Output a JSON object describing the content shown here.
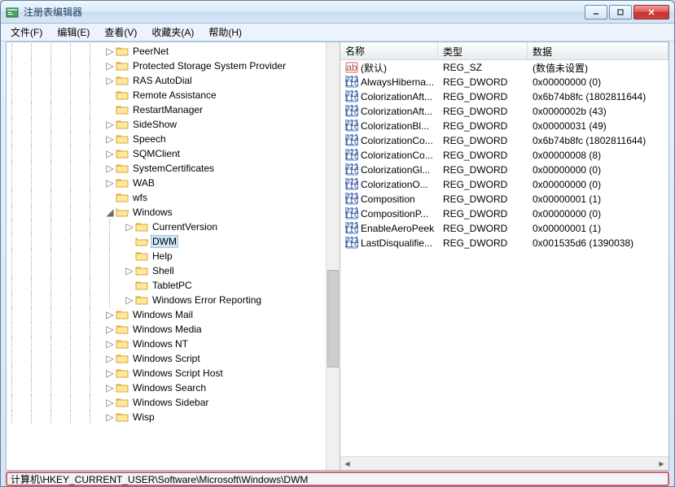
{
  "window": {
    "title": "注册表编辑器"
  },
  "menu": {
    "file": "文件(F)",
    "edit": "编辑(E)",
    "view": "查看(V)",
    "favorites": "收藏夹(A)",
    "help": "帮助(H)"
  },
  "tree": {
    "items": [
      {
        "depth": 5,
        "exp": "closed",
        "label": "PeerNet"
      },
      {
        "depth": 5,
        "exp": "closed",
        "label": "Protected Storage System Provider"
      },
      {
        "depth": 5,
        "exp": "closed",
        "label": "RAS AutoDial"
      },
      {
        "depth": 5,
        "exp": "none",
        "label": "Remote Assistance"
      },
      {
        "depth": 5,
        "exp": "none",
        "label": "RestartManager"
      },
      {
        "depth": 5,
        "exp": "closed",
        "label": "SideShow"
      },
      {
        "depth": 5,
        "exp": "closed",
        "label": "Speech"
      },
      {
        "depth": 5,
        "exp": "closed",
        "label": "SQMClient"
      },
      {
        "depth": 5,
        "exp": "closed",
        "label": "SystemCertificates"
      },
      {
        "depth": 5,
        "exp": "closed",
        "label": "WAB"
      },
      {
        "depth": 5,
        "exp": "none",
        "label": "wfs"
      },
      {
        "depth": 5,
        "exp": "open",
        "label": "Windows"
      },
      {
        "depth": 6,
        "exp": "closed",
        "label": "CurrentVersion"
      },
      {
        "depth": 6,
        "exp": "none",
        "label": "DWM",
        "selected": true
      },
      {
        "depth": 6,
        "exp": "none",
        "label": "Help"
      },
      {
        "depth": 6,
        "exp": "closed",
        "label": "Shell"
      },
      {
        "depth": 6,
        "exp": "none",
        "label": "TabletPC"
      },
      {
        "depth": 6,
        "exp": "closed",
        "label": "Windows Error Reporting"
      },
      {
        "depth": 5,
        "exp": "closed",
        "label": "Windows Mail"
      },
      {
        "depth": 5,
        "exp": "closed",
        "label": "Windows Media"
      },
      {
        "depth": 5,
        "exp": "closed",
        "label": "Windows NT"
      },
      {
        "depth": 5,
        "exp": "closed",
        "label": "Windows Script"
      },
      {
        "depth": 5,
        "exp": "closed",
        "label": "Windows Script Host"
      },
      {
        "depth": 5,
        "exp": "closed",
        "label": "Windows Search"
      },
      {
        "depth": 5,
        "exp": "closed",
        "label": "Windows Sidebar"
      },
      {
        "depth": 5,
        "exp": "closed",
        "label": "Wisp"
      }
    ]
  },
  "list": {
    "headers": {
      "name": "名称",
      "type": "类型",
      "data": "数据"
    },
    "rows": [
      {
        "icon": "str",
        "name": "(默认)",
        "type": "REG_SZ",
        "data": "(数值未设置)"
      },
      {
        "icon": "bin",
        "name": "AlwaysHiberna...",
        "type": "REG_DWORD",
        "data": "0x00000000 (0)"
      },
      {
        "icon": "bin",
        "name": "ColorizationAft...",
        "type": "REG_DWORD",
        "data": "0x6b74b8fc (1802811644)"
      },
      {
        "icon": "bin",
        "name": "ColorizationAft...",
        "type": "REG_DWORD",
        "data": "0x0000002b (43)"
      },
      {
        "icon": "bin",
        "name": "ColorizationBl...",
        "type": "REG_DWORD",
        "data": "0x00000031 (49)"
      },
      {
        "icon": "bin",
        "name": "ColorizationCo...",
        "type": "REG_DWORD",
        "data": "0x6b74b8fc (1802811644)"
      },
      {
        "icon": "bin",
        "name": "ColorizationCo...",
        "type": "REG_DWORD",
        "data": "0x00000008 (8)"
      },
      {
        "icon": "bin",
        "name": "ColorizationGl...",
        "type": "REG_DWORD",
        "data": "0x00000000 (0)"
      },
      {
        "icon": "bin",
        "name": "ColorizationO...",
        "type": "REG_DWORD",
        "data": "0x00000000 (0)"
      },
      {
        "icon": "bin",
        "name": "Composition",
        "type": "REG_DWORD",
        "data": "0x00000001 (1)"
      },
      {
        "icon": "bin",
        "name": "CompositionP...",
        "type": "REG_DWORD",
        "data": "0x00000000 (0)"
      },
      {
        "icon": "bin",
        "name": "EnableAeroPeek",
        "type": "REG_DWORD",
        "data": "0x00000001 (1)"
      },
      {
        "icon": "bin",
        "name": "LastDisqualifie...",
        "type": "REG_DWORD",
        "data": "0x001535d6 (1390038)"
      }
    ]
  },
  "statusbar": {
    "path": "计算机\\HKEY_CURRENT_USER\\Software\\Microsoft\\Windows\\DWM"
  }
}
